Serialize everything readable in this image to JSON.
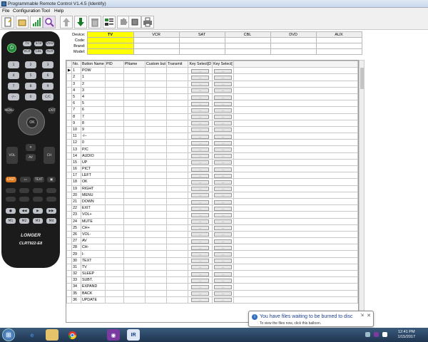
{
  "window": {
    "title": "Programmable Remote Control V1.4.5 (Identify)"
  },
  "menu": {
    "items": [
      "File",
      "Configuration",
      "Tool",
      "Help"
    ]
  },
  "toolbar": {
    "buttons": [
      "new-document-icon",
      "open-icon",
      "signal-bars-icon",
      "search-zoom-icon",
      "arrow-up-icon",
      "download-arrow-icon",
      "trash-icon",
      "list-icon",
      "puzzle-icon",
      "chip-icon",
      "printer-icon"
    ]
  },
  "remote": {
    "top_buttons": [
      "TV",
      "STB",
      "DVD",
      "VCR",
      "CBL",
      "AUX"
    ],
    "numbers": [
      "1",
      "2",
      "3",
      "4",
      "5",
      "6",
      "7",
      "8",
      "9",
      "-/--",
      "0",
      "C/C"
    ],
    "ok_label": "OK",
    "side_labels": [
      "MENU",
      "EXIT",
      "VOL",
      "CH"
    ],
    "text_buttons": [
      "LAST",
      "TEXT"
    ],
    "brand_line1": "LONGER",
    "brand_line2": "CLRT922-E8"
  },
  "devices": {
    "row_labels": [
      "Device:",
      "Code:",
      "Brand:",
      "Model:"
    ],
    "columns": [
      "TV",
      "VCR",
      "SAT",
      "CBL",
      "DVD",
      "AUX"
    ],
    "selected": "TV"
  },
  "grid": {
    "headers": [
      "No.",
      "Button Name",
      "PID",
      "PName",
      "Custom but",
      "Transmit",
      "Key Select[D",
      "Key Select["
    ],
    "rows": [
      [
        "1",
        "POW"
      ],
      [
        "2",
        "1"
      ],
      [
        "3",
        "2"
      ],
      [
        "4",
        "3"
      ],
      [
        "5",
        "4"
      ],
      [
        "6",
        "5"
      ],
      [
        "7",
        "6"
      ],
      [
        "8",
        "7"
      ],
      [
        "9",
        "8"
      ],
      [
        "10",
        "9"
      ],
      [
        "11",
        "-/--"
      ],
      [
        "12",
        "0"
      ],
      [
        "13",
        "P/C"
      ],
      [
        "14",
        "AUDIO"
      ],
      [
        "15",
        "UP"
      ],
      [
        "16",
        "PICT"
      ],
      [
        "17",
        "LEFT"
      ],
      [
        "18",
        "OK"
      ],
      [
        "19",
        "RIGHT"
      ],
      [
        "20",
        "MENU"
      ],
      [
        "21",
        "DOWN"
      ],
      [
        "22",
        "EXIT"
      ],
      [
        "23",
        "VOL+"
      ],
      [
        "24",
        "MUTE"
      ],
      [
        "25",
        "CH+"
      ],
      [
        "26",
        "VOL-"
      ],
      [
        "27",
        "AV"
      ],
      [
        "28",
        "CH-"
      ],
      [
        "29",
        "I-"
      ],
      [
        "30",
        "TEXT"
      ],
      [
        "31",
        "TV"
      ],
      [
        "32",
        "SLEEP"
      ],
      [
        "33",
        "SUBT."
      ],
      [
        "34",
        "EXPAND"
      ],
      [
        "35",
        "BACK"
      ],
      [
        "36",
        "UPDATE"
      ]
    ],
    "key_button_label": "..."
  },
  "notification": {
    "title": "You have files waiting to be burned to disc",
    "body": "To view the files now, click this balloon."
  },
  "taskbar": {
    "apps": [
      "ie-icon",
      "folder-icon",
      "chrome-icon",
      "media-icon",
      "remote-app-icon"
    ],
    "time": "12:41 PM",
    "date": "1/15/2017"
  }
}
